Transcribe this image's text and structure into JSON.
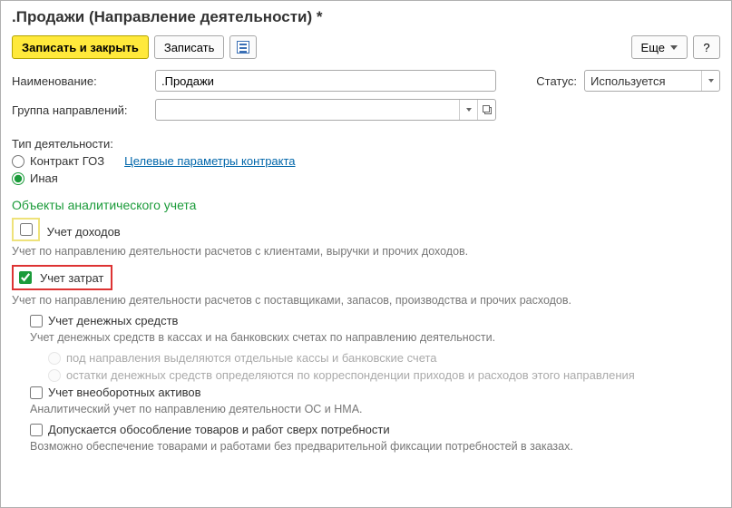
{
  "title": ".Продажи (Направление деятельности) *",
  "toolbar": {
    "save_close": "Записать и закрыть",
    "save": "Записать",
    "more": "Еще",
    "help": "?"
  },
  "fields": {
    "name_label": "Наименование:",
    "name_value": ".Продажи",
    "status_label": "Статус:",
    "status_value": "Используется",
    "group_label": "Группа направлений:",
    "group_value": ""
  },
  "activity": {
    "type_label": "Тип деятельности:",
    "radio_goz": "Контракт ГОЗ",
    "goz_link": "Целевые параметры контракта",
    "radio_other": "Иная"
  },
  "analytics": {
    "section": "Объекты аналитического учета",
    "income_label": "Учет доходов",
    "income_hint": "Учет по направлению деятельности расчетов с клиентами, выручки и прочих доходов.",
    "cost_label": "Учет затрат",
    "cost_hint": "Учет по направлению деятельности расчетов с поставщиками, запасов, производства и прочих расходов.",
    "cash_label": "Учет денежных средств",
    "cash_hint": "Учет денежных средств в кассах и на банковских счетах по направлению деятельности.",
    "cash_sub1": "под направления выделяются отдельные кассы и банковские счета",
    "cash_sub2": "остатки денежных средств определяются по корреспонденции приходов и расходов этого направления",
    "assets_label": "Учет внеоборотных активов",
    "assets_hint": "Аналитический учет по направлению деятельности ОС и НМА.",
    "goods_label": "Допускается обособление товаров и работ сверх потребности",
    "goods_hint": "Возможно обеспечение товарами и работами без предварительной фиксации потребностей в заказах."
  }
}
